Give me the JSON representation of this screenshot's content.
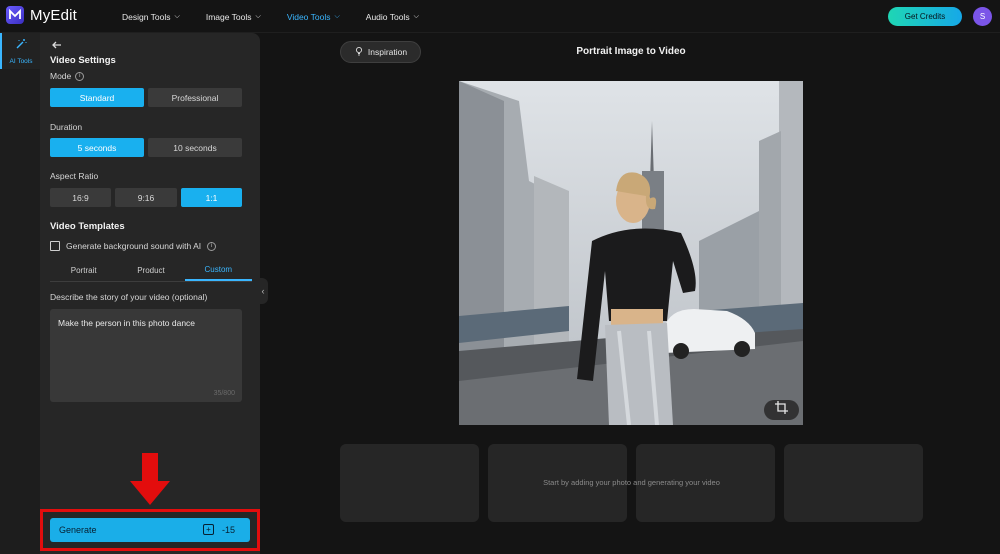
{
  "app": {
    "name": "MyEdit",
    "logo_icon": "myedit-logo-icon"
  },
  "nav": [
    {
      "label": "Design Tools",
      "active": false
    },
    {
      "label": "Image Tools",
      "active": false
    },
    {
      "label": "Video Tools",
      "active": true
    },
    {
      "label": "Audio Tools",
      "active": false
    }
  ],
  "header": {
    "credits_label": "Get Credits",
    "avatar_initial": "S"
  },
  "rail": {
    "tool_label": "AI Tools",
    "tool_icon": "magic-wand-icon"
  },
  "settings": {
    "title": "Video Settings",
    "mode": {
      "label": "Mode",
      "options": [
        "Standard",
        "Professional"
      ],
      "selected": "Standard"
    },
    "duration": {
      "label": "Duration",
      "options": [
        "5 seconds",
        "10 seconds"
      ],
      "selected": "5 seconds"
    },
    "aspect": {
      "label": "Aspect Ratio",
      "options": [
        "16:9",
        "9:16",
        "1:1"
      ],
      "selected": "1:1"
    }
  },
  "templates": {
    "title": "Video Templates",
    "bg_sound_label": "Generate background sound with AI",
    "bg_sound_checked": false,
    "tabs": [
      "Portrait",
      "Product",
      "Custom"
    ],
    "active_tab": "Custom"
  },
  "prompt": {
    "label": "Describe the story of your video (optional)",
    "value": "Make the person in this photo dance",
    "counter": "35/800"
  },
  "generate": {
    "label": "Generate",
    "cost": "-15"
  },
  "stage": {
    "inspiration_label": "Inspiration",
    "title": "Portrait Image to Video",
    "empty_message": "Start by adding your photo and generating your video"
  },
  "colors": {
    "accent": "#19b0ef",
    "highlight": "#e30d0d",
    "credits_gradient_start": "#1fd6b4"
  }
}
